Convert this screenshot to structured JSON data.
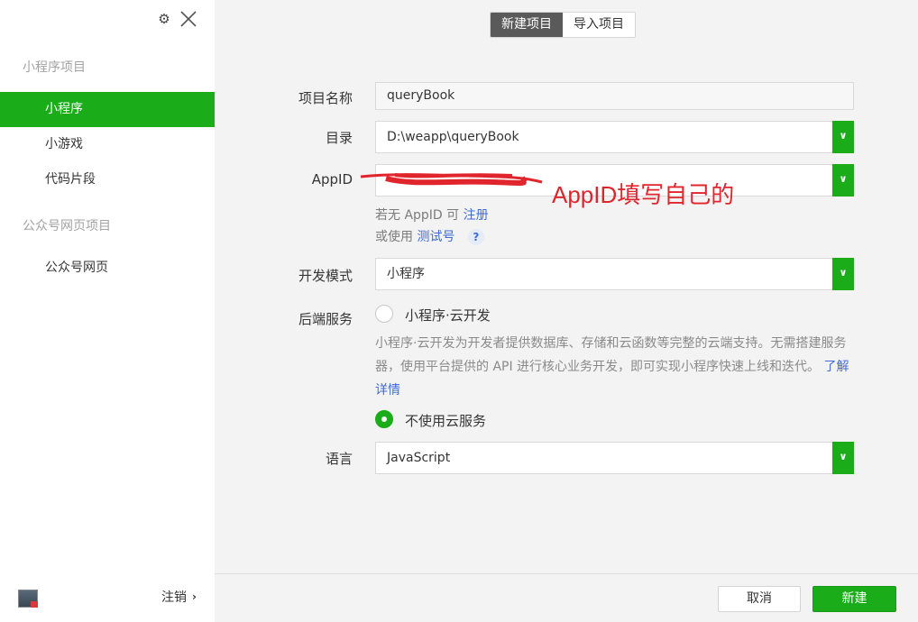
{
  "sidebar": {
    "group1_title": "小程序项目",
    "items_group1": [
      "小程序",
      "小游戏",
      "代码片段"
    ],
    "group2_title": "公众号网页项目",
    "items_group2": [
      "公众号网页"
    ],
    "logout_label": "注销",
    "active_item": "小程序"
  },
  "tabs": {
    "new_project": "新建项目",
    "import_project": "导入项目"
  },
  "form": {
    "name_label": "项目名称",
    "name_value": "queryBook",
    "dir_label": "目录",
    "dir_value": "D:\\weapp\\queryBook",
    "appid_label": "AppID",
    "appid_value": "",
    "no_appid_text": "若无 AppID 可",
    "register_link": "注册",
    "or_use_text": "或使用",
    "test_account_link": "测试号",
    "help_icon": "?",
    "devmode_label": "开发模式",
    "devmode_value": "小程序",
    "backend_label": "后端服务",
    "cloud_option": "小程序·云开发",
    "cloud_desc": "小程序·云开发为开发者提供数据库、存储和云函数等完整的云端支持。无需搭建服务器，使用平台提供的 API 进行核心业务开发，即可实现小程序快速上线和迭代。",
    "learn_more_link": "了解详情",
    "no_cloud_option": "不使用云服务",
    "lang_label": "语言",
    "lang_value": "JavaScript"
  },
  "annotation": "AppID填写自己的",
  "footer": {
    "cancel_label": "取消",
    "create_label": "新建"
  },
  "colors": {
    "accent": "#1aad19",
    "link": "#3f6ad8",
    "annotation": "#e0262c"
  }
}
